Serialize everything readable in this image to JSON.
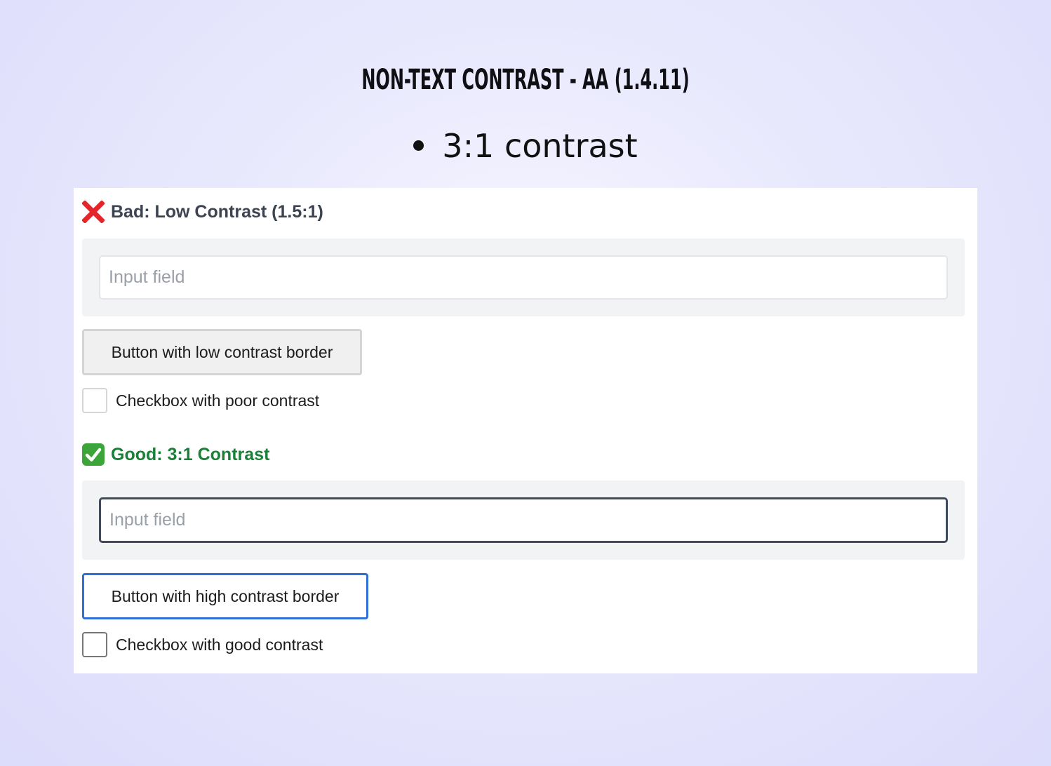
{
  "slide": {
    "title": "NON-TEXT CONTRAST - AA (1.4.11)",
    "bullets": [
      "3:1 contrast"
    ]
  },
  "bad_example": {
    "heading": "Bad: Low Contrast (1.5:1)",
    "icon": "cross-mark-icon",
    "input_placeholder": "Input field",
    "input_value": "",
    "button_label": "Button with low contrast border",
    "checkbox_label": "Checkbox with poor contrast",
    "checkbox_checked": false
  },
  "good_example": {
    "heading": "Good: 3:1 Contrast",
    "icon": "check-mark-button-icon",
    "input_placeholder": "Input field",
    "input_value": "",
    "button_label": "Button with high contrast border",
    "checkbox_label": "Checkbox with good contrast",
    "checkbox_checked": false
  },
  "colors": {
    "bad_heading": "#3d4451",
    "good_heading": "#1a7f37",
    "bad_input_border": "#e3e5e8",
    "good_input_border": "#3f4a5c",
    "bad_button_border": "#d4d4d4",
    "good_button_border": "#2f6fd6",
    "cross_icon": "#e5252a",
    "check_icon_bg": "#3ba53a"
  }
}
